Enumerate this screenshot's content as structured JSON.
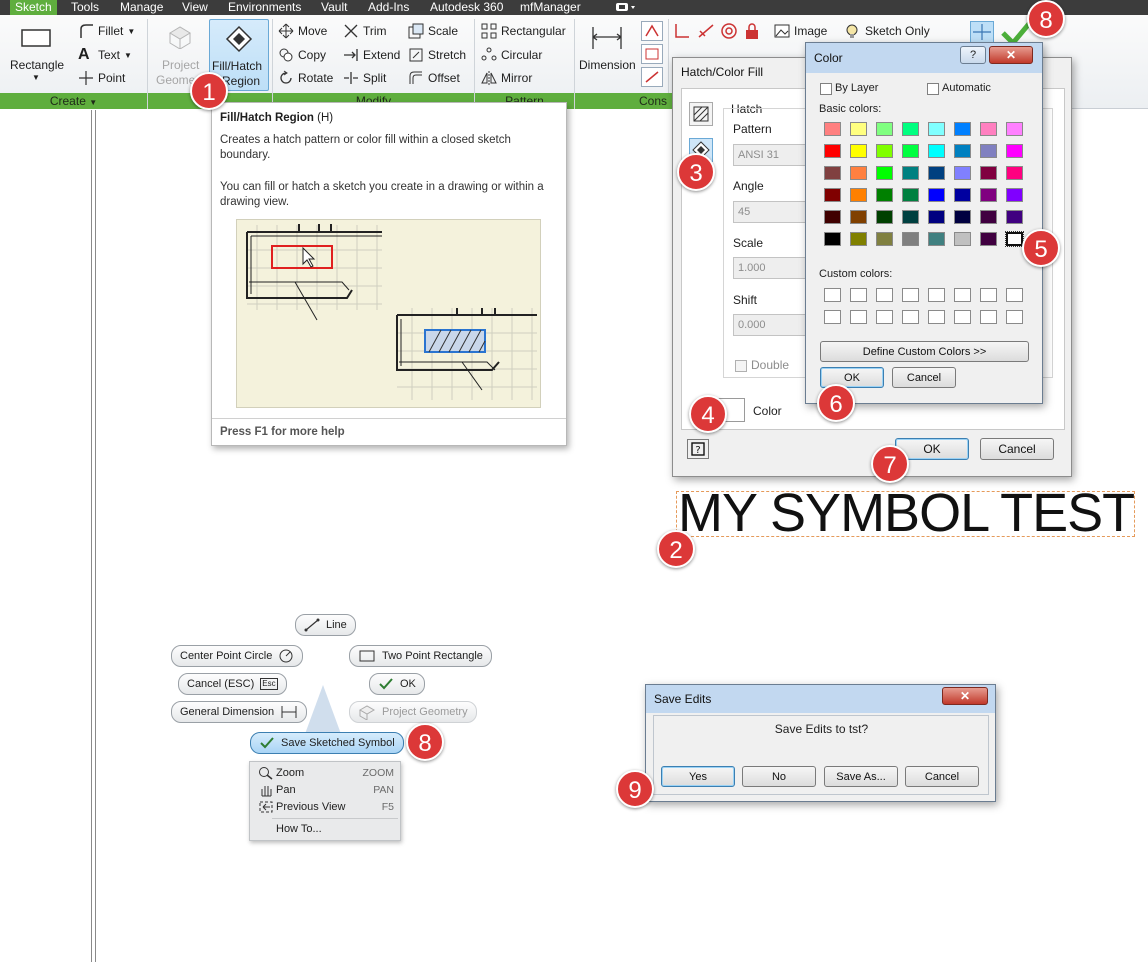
{
  "menubar": {
    "items": [
      "Sketch",
      "Tools",
      "Manage",
      "View",
      "Environments",
      "Vault",
      "Add-Ins",
      "Autodesk 360",
      "mfManager"
    ]
  },
  "ribbon": {
    "create": {
      "rectangle": "Rectangle",
      "fillet": "Fillet",
      "text": "Text",
      "point": "Point",
      "project_geometry_1": "Project",
      "project_geometry_2": "Geome",
      "fill_hatch_1": "Fill/Hatch",
      "fill_hatch_2": "Region",
      "panel_title": "Create"
    },
    "modify": {
      "move": "Move",
      "trim": "Trim",
      "scale": "Scale",
      "copy": "Copy",
      "extend": "Extend",
      "stretch": "Stretch",
      "rotate": "Rotate",
      "split": "Split",
      "offset": "Offset",
      "panel_title": "Modify"
    },
    "pattern": {
      "rectangular": "Rectangular",
      "circular": "Circular",
      "mirror": "Mirror",
      "panel_title": "Pattern"
    },
    "constrain": {
      "dimension": "Dimension",
      "panel_title": "Cons"
    },
    "format": {
      "image": "Image",
      "sketch_only": "Sketch Only"
    }
  },
  "tooltip": {
    "title": "Fill/Hatch Region",
    "shortcut": "(H)",
    "desc1": "Creates a hatch pattern or color fill within a closed sketch boundary.",
    "desc2": "You can fill or hatch a sketch you create in a drawing or within a drawing view.",
    "help": "Press F1 for more help"
  },
  "hatch_dialog": {
    "title": "Hatch/Color Fill",
    "group": "Hatch",
    "pattern_label": "Pattern",
    "pattern_value": "ANSI 31",
    "angle_label": "Angle",
    "angle_value": "45",
    "scale_label": "Scale",
    "scale_value": "1.000",
    "shift_label": "Shift",
    "shift_value": "0.000",
    "double_label": "Double",
    "color_label": "Color",
    "ok": "OK",
    "cancel": "Cancel"
  },
  "color_dialog": {
    "title": "Color",
    "help_btn": "?",
    "by_layer": "By Layer",
    "automatic": "Automatic",
    "basic_colors_label": "Basic colors:",
    "basic_colors": [
      [
        "#ff8080",
        "#ffff80",
        "#80ff80",
        "#00ff80",
        "#80ffff",
        "#0080ff",
        "#ff80c0",
        "#ff80ff"
      ],
      [
        "#ff0000",
        "#ffff00",
        "#80ff00",
        "#00ff40",
        "#00ffff",
        "#0080c0",
        "#8080c0",
        "#ff00ff"
      ],
      [
        "#804040",
        "#ff8040",
        "#00ff00",
        "#008080",
        "#004080",
        "#8080ff",
        "#800040",
        "#ff0080"
      ],
      [
        "#800000",
        "#ff8000",
        "#008000",
        "#008040",
        "#0000ff",
        "#0000a0",
        "#800080",
        "#8000ff"
      ],
      [
        "#400000",
        "#804000",
        "#004000",
        "#004040",
        "#000080",
        "#000040",
        "#400040",
        "#400080"
      ],
      [
        "#000000",
        "#808000",
        "#808040",
        "#808080",
        "#408080",
        "#c0c0c0",
        "#400040",
        "#ffffff"
      ]
    ],
    "custom_colors_label": "Custom colors:",
    "define_custom": "Define Custom Colors >>",
    "ok": "OK",
    "cancel": "Cancel"
  },
  "sketch_text": "MY SYMBOL TEST",
  "marking_menu": {
    "line": "Line",
    "center_point_circle": "Center Point Circle",
    "two_point_rectangle": "Two Point Rectangle",
    "cancel_esc": "Cancel (ESC)",
    "esc_key": "Esc",
    "ok": "OK",
    "general_dimension": "General Dimension",
    "project_geometry": "Project Geometry",
    "save_sketched_symbol": "Save Sketched Symbol"
  },
  "context_menu": {
    "items": [
      {
        "label": "Zoom",
        "key": "ZOOM"
      },
      {
        "label": "Pan",
        "key": "PAN"
      },
      {
        "label": "Previous View",
        "key": "F5"
      },
      {
        "label": "How To...",
        "key": ""
      }
    ]
  },
  "save_dialog": {
    "title": "Save Edits",
    "message": "Save Edits to tst?",
    "yes": "Yes",
    "no": "No",
    "save_as": "Save As...",
    "cancel": "Cancel"
  },
  "steps": [
    "1",
    "2",
    "3",
    "4",
    "5",
    "6",
    "7",
    "8",
    "8",
    "9"
  ]
}
